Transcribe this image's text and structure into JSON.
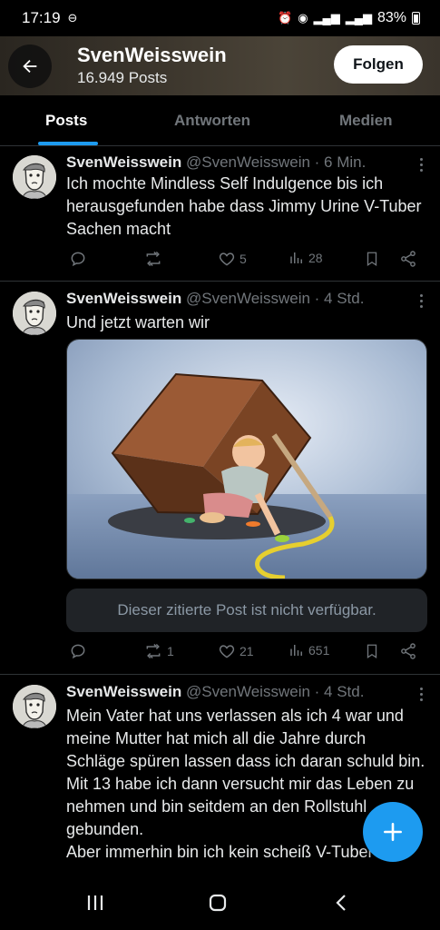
{
  "status_bar": {
    "time": "17:19",
    "battery": "83%"
  },
  "header": {
    "name": "SvenWeisswein",
    "post_count": "16.949 Posts",
    "follow_label": "Folgen"
  },
  "tabs": [
    {
      "label": "Posts",
      "active": true
    },
    {
      "label": "Antworten",
      "active": false
    },
    {
      "label": "Medien",
      "active": false
    }
  ],
  "posts": [
    {
      "name": "SvenWeisswein",
      "meta": "@SvenWeisswein · 6 Min.",
      "text": "Ich mochte Mindless Self Indulgence bis ich herausgefunden habe dass Jimmy Urine V-Tuber Sachen macht",
      "replies": "",
      "reposts": "",
      "likes": "5",
      "views": "28"
    },
    {
      "name": "SvenWeisswein",
      "meta": "@SvenWeisswein · 4 Std.",
      "text": "Und jetzt warten wir",
      "quoted_unavailable": "Dieser zitierte Post ist nicht verfügbar.",
      "replies": "",
      "reposts": "1",
      "likes": "21",
      "views": "651"
    },
    {
      "name": "SvenWeisswein",
      "meta": "@SvenWeisswein · 4 Std.",
      "text": "Mein Vater hat uns verlassen als ich 4 war und meine Mutter hat mich all die Jahre durch Schläge spüren lassen dass ich daran schuld bin. Mit 13 habe ich dann versucht mir das Leben zu nehmen und bin seitdem an den Rollstuhl gebunden.\nAber immerhin bin ich kein scheiß V-Tuber"
    }
  ],
  "colors": {
    "accent": "#1d9bf0",
    "muted": "#71767b",
    "divider": "#2f3336"
  },
  "icons": [
    "back-arrow-icon",
    "more-icon",
    "reply-icon",
    "repost-icon",
    "like-icon",
    "views-icon",
    "bookmark-icon",
    "share-icon",
    "compose-plus-icon"
  ]
}
